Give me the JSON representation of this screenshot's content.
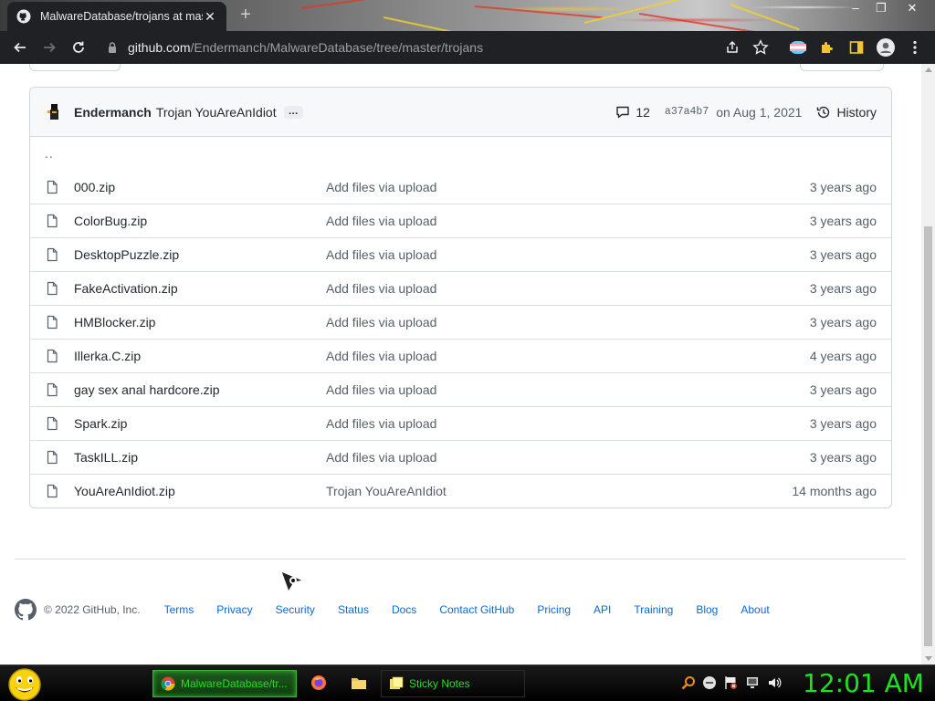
{
  "browser": {
    "tab_title": "MalwareDatabase/trojans at mas",
    "url_host": "github.com",
    "url_path": "/Endermanch/MalwareDatabase/tree/master/trojans"
  },
  "commit": {
    "author": "Endermanch",
    "message": "Trojan YouAreAnIdiot",
    "ellipsis": "…",
    "comments": "12",
    "sha": "a37a4b7",
    "date": "on Aug 1, 2021",
    "history_label": "History"
  },
  "parent_dir": "..",
  "files": [
    {
      "name": "000.zip",
      "message": "Add files via upload",
      "age": "3 years ago"
    },
    {
      "name": "ColorBug.zip",
      "message": "Add files via upload",
      "age": "3 years ago"
    },
    {
      "name": "DesktopPuzzle.zip",
      "message": "Add files via upload",
      "age": "3 years ago"
    },
    {
      "name": "FakeActivation.zip",
      "message": "Add files via upload",
      "age": "3 years ago"
    },
    {
      "name": "HMBlocker.zip",
      "message": "Add files via upload",
      "age": "3 years ago"
    },
    {
      "name": "Illerka.C.zip",
      "message": "Add files via upload",
      "age": "4 years ago"
    },
    {
      "name": "gay sex anal hardcore.zip",
      "message": "Add files via upload",
      "age": "3 years ago"
    },
    {
      "name": "Spark.zip",
      "message": "Add files via upload",
      "age": "3 years ago"
    },
    {
      "name": "TaskILL.zip",
      "message": "Add files via upload",
      "age": "3 years ago"
    },
    {
      "name": "YouAreAnIdiot.zip",
      "message": "Trojan YouAreAnIdiot",
      "age": "14 months ago"
    }
  ],
  "footer": {
    "copyright": "© 2022 GitHub, Inc.",
    "links": [
      "Terms",
      "Privacy",
      "Security",
      "Status",
      "Docs",
      "Contact GitHub",
      "Pricing",
      "API",
      "Training",
      "Blog",
      "About"
    ]
  },
  "taskbar": {
    "tasks": [
      {
        "label": "MalwareDatabase/tr...",
        "icon": "chrome-icon"
      },
      {
        "label": "Sticky Notes",
        "icon": "sticky-notes-icon"
      }
    ],
    "clock": "12:01 AM"
  },
  "colors": {
    "link": "#0969da",
    "muted_text": "#57606a",
    "border": "#d0d7de",
    "taskbar_text": "#25e025"
  }
}
